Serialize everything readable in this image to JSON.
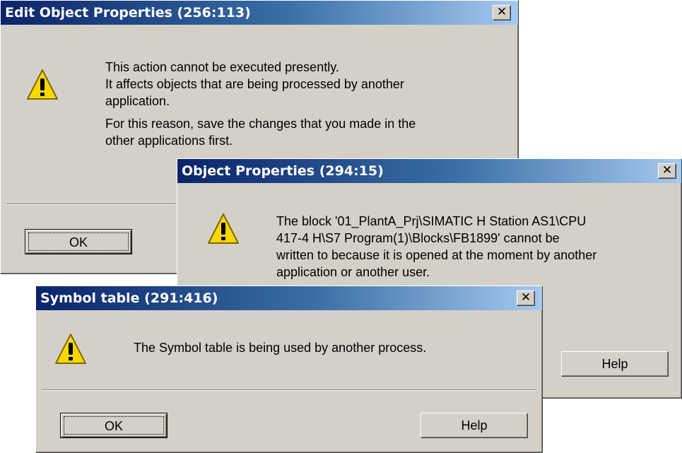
{
  "dialog1": {
    "title": "Edit Object Properties (256:113)",
    "close_label": "✕",
    "message_lines": [
      "This action cannot be executed presently.",
      "It affects objects that are being processed by another",
      "application."
    ],
    "message_lines_2": [
      "For this reason, save the changes that you made in the",
      "other applications first."
    ],
    "ok_label": "OK",
    "icon": "warning-icon"
  },
  "dialog2": {
    "title": "Object Properties  (294:15)",
    "close_label": "✕",
    "message_lines": [
      "The block '01_PlantA_Prj\\SIMATIC H Station AS1\\CPU",
      "417-4 H\\S7 Program(1)\\Blocks\\FB1899' cannot be",
      "written to because it is opened at the moment by another",
      "application or another user."
    ],
    "help_label": "Help",
    "icon": "warning-icon"
  },
  "dialog3": {
    "title": "Symbol table (291:416)",
    "close_label": "✕",
    "message": "The Symbol table is being used by another process.",
    "ok_label": "OK",
    "help_label": "Help",
    "icon": "warning-icon"
  },
  "colors": {
    "title_start": "#0a246a",
    "title_end": "#a6caf0",
    "face": "#d4d0c8",
    "warning_yellow": "#f8d800"
  }
}
